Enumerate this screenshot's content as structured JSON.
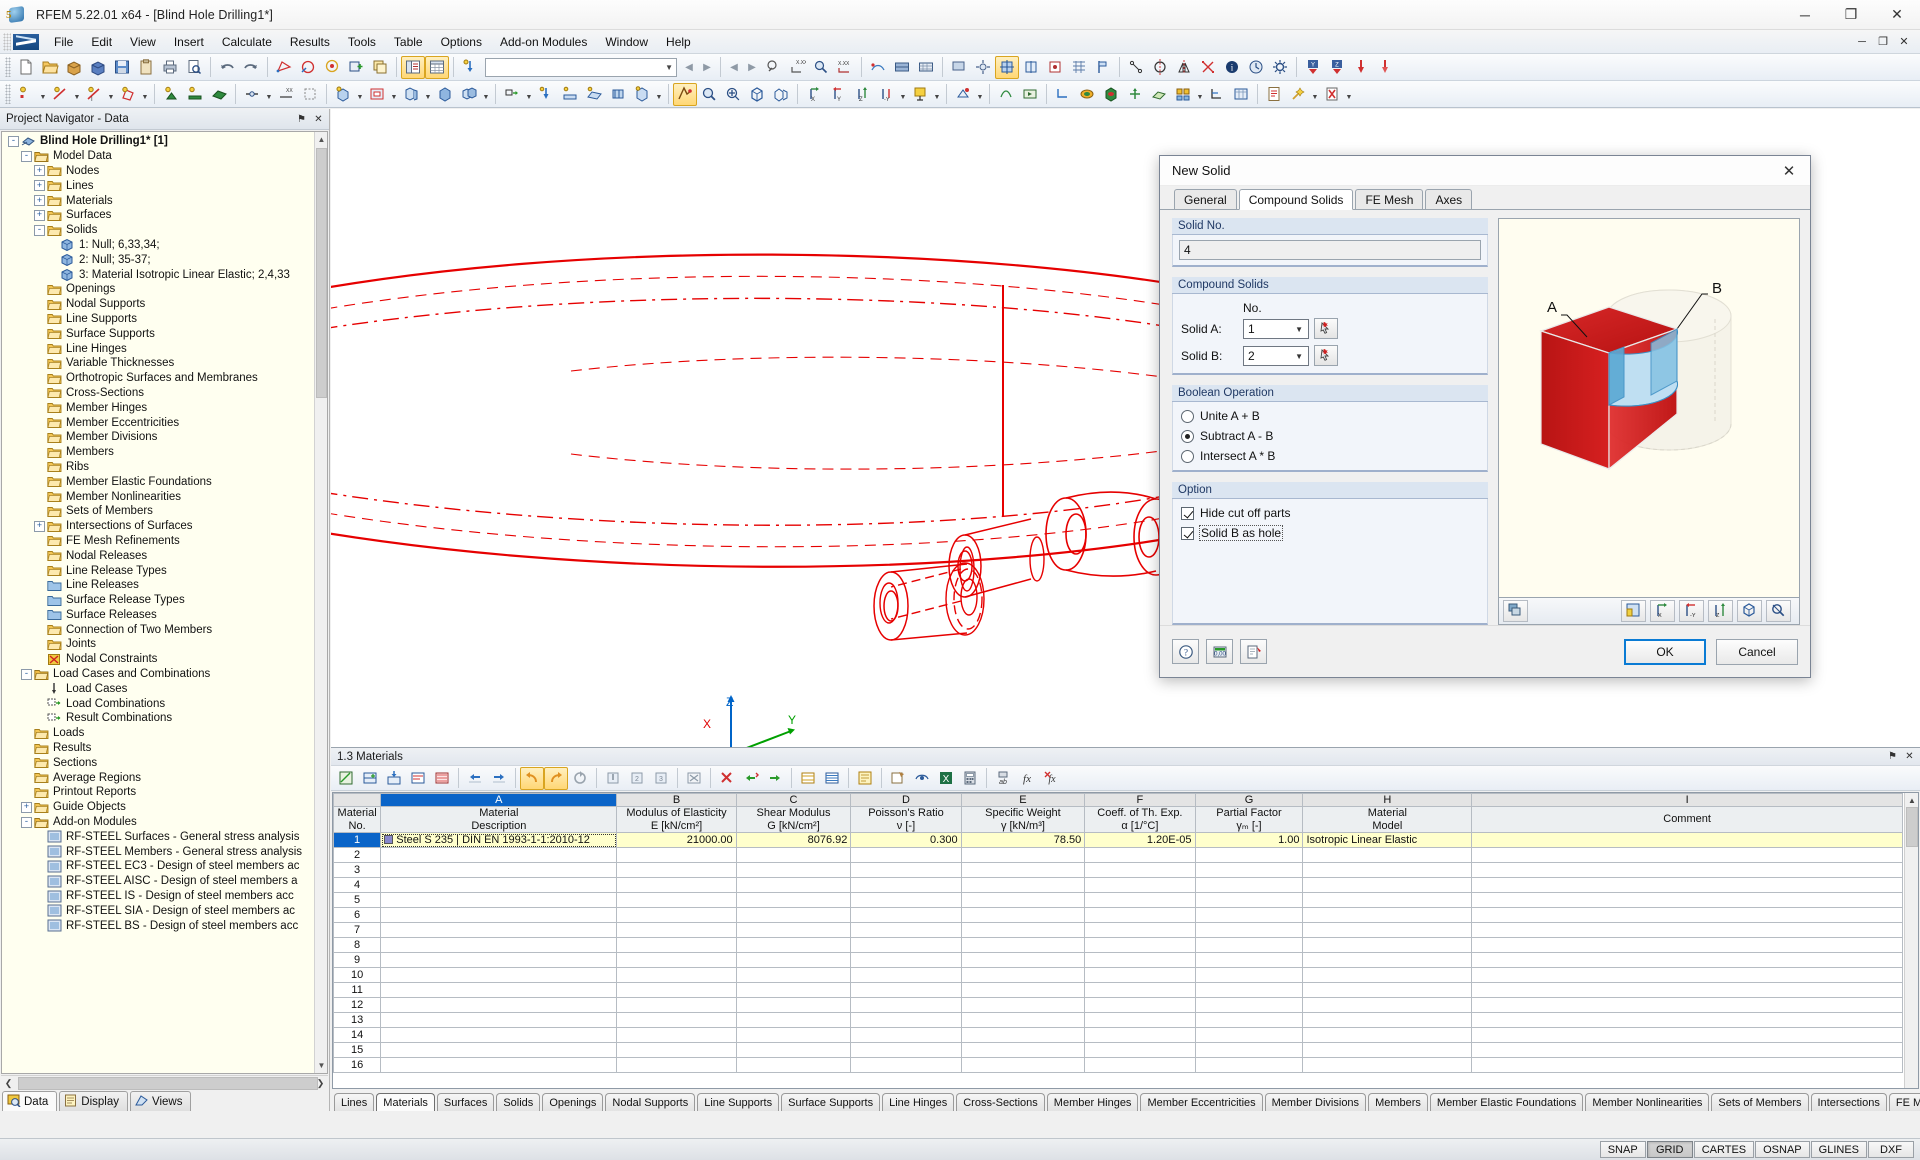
{
  "window": {
    "title": "RFEM 5.22.01 x64 - [Blind Hole Drilling1*]",
    "minimize": "─",
    "maximize": "❐",
    "close": "✕",
    "mdi_minimize": "─",
    "mdi_restore": "❐",
    "mdi_close": "✕"
  },
  "menu": {
    "items": [
      "File",
      "Edit",
      "View",
      "Insert",
      "Calculate",
      "Results",
      "Tools",
      "Table",
      "Options",
      "Add-on Modules",
      "Window",
      "Help"
    ]
  },
  "toolbar": {
    "combo_value": "",
    "prev_label": "◀",
    "next_label": "▶"
  },
  "navigator": {
    "title": "Project Navigator - Data",
    "pin": "⚑",
    "close": "✕",
    "tree": [
      {
        "depth": 0,
        "toggle": "-",
        "label": "Blind Hole Drilling1* [1]",
        "bold": true,
        "icon": "model-icon"
      },
      {
        "depth": 1,
        "toggle": "-",
        "label": "Model Data",
        "icon": "folder-open-icon"
      },
      {
        "depth": 2,
        "toggle": "+",
        "label": "Nodes",
        "icon": "nodes-icon"
      },
      {
        "depth": 2,
        "toggle": "+",
        "label": "Lines",
        "icon": "lines-icon"
      },
      {
        "depth": 2,
        "toggle": "+",
        "label": "Materials",
        "icon": "materials-icon"
      },
      {
        "depth": 2,
        "toggle": "+",
        "label": "Surfaces",
        "icon": "surfaces-icon"
      },
      {
        "depth": 2,
        "toggle": "-",
        "label": "Solids",
        "icon": "solids-icon"
      },
      {
        "depth": 3,
        "toggle": "",
        "label": "1: Null; 6,33,34;",
        "icon": "solid-item-icon"
      },
      {
        "depth": 3,
        "toggle": "",
        "label": "2: Null; 35-37;",
        "icon": "solid-item-icon"
      },
      {
        "depth": 3,
        "toggle": "",
        "label": "3: Material Isotropic Linear Elastic; 2,4,33",
        "icon": "solid-item-icon"
      },
      {
        "depth": 2,
        "toggle": "",
        "label": "Openings",
        "icon": "openings-icon"
      },
      {
        "depth": 2,
        "toggle": "",
        "label": "Nodal Supports",
        "icon": "nodal-supports-icon"
      },
      {
        "depth": 2,
        "toggle": "",
        "label": "Line Supports",
        "icon": "line-supports-icon"
      },
      {
        "depth": 2,
        "toggle": "",
        "label": "Surface Supports",
        "icon": "surface-supports-icon"
      },
      {
        "depth": 2,
        "toggle": "",
        "label": "Line Hinges",
        "icon": "line-hinges-icon"
      },
      {
        "depth": 2,
        "toggle": "",
        "label": "Variable Thicknesses",
        "icon": "variable-thickness-icon"
      },
      {
        "depth": 2,
        "toggle": "",
        "label": "Orthotropic Surfaces and Membranes",
        "icon": "orthotropic-icon"
      },
      {
        "depth": 2,
        "toggle": "",
        "label": "Cross-Sections",
        "icon": "cross-sections-icon"
      },
      {
        "depth": 2,
        "toggle": "",
        "label": "Member Hinges",
        "icon": "member-hinges-icon"
      },
      {
        "depth": 2,
        "toggle": "",
        "label": "Member Eccentricities",
        "icon": "member-ecc-icon"
      },
      {
        "depth": 2,
        "toggle": "",
        "label": "Member Divisions",
        "icon": "member-div-icon"
      },
      {
        "depth": 2,
        "toggle": "",
        "label": "Members",
        "icon": "members-icon"
      },
      {
        "depth": 2,
        "toggle": "",
        "label": "Ribs",
        "icon": "ribs-icon"
      },
      {
        "depth": 2,
        "toggle": "",
        "label": "Member Elastic Foundations",
        "icon": "member-found-icon"
      },
      {
        "depth": 2,
        "toggle": "",
        "label": "Member Nonlinearities",
        "icon": "member-nonlin-icon"
      },
      {
        "depth": 2,
        "toggle": "",
        "label": "Sets of Members",
        "icon": "sets-members-icon"
      },
      {
        "depth": 2,
        "toggle": "+",
        "label": "Intersections of Surfaces",
        "icon": "intersections-icon"
      },
      {
        "depth": 2,
        "toggle": "",
        "label": "FE Mesh Refinements",
        "icon": "fe-mesh-icon"
      },
      {
        "depth": 2,
        "toggle": "",
        "label": "Nodal Releases",
        "icon": "folder-icon"
      },
      {
        "depth": 2,
        "toggle": "",
        "label": "Line Release Types",
        "icon": "folder-icon"
      },
      {
        "depth": 2,
        "toggle": "",
        "label": "Line Releases",
        "icon": "folder-blue-icon"
      },
      {
        "depth": 2,
        "toggle": "",
        "label": "Surface Release Types",
        "icon": "folder-blue-icon"
      },
      {
        "depth": 2,
        "toggle": "",
        "label": "Surface Releases",
        "icon": "folder-blue-icon"
      },
      {
        "depth": 2,
        "toggle": "",
        "label": "Connection of Two Members",
        "icon": "folder-icon"
      },
      {
        "depth": 2,
        "toggle": "",
        "label": "Joints",
        "icon": "folder-icon"
      },
      {
        "depth": 2,
        "toggle": "",
        "label": "Nodal Constraints",
        "icon": "nodal-constraints-icon"
      },
      {
        "depth": 1,
        "toggle": "-",
        "label": "Load Cases and Combinations",
        "icon": "folder-open-icon"
      },
      {
        "depth": 2,
        "toggle": "",
        "label": "Load Cases",
        "icon": "load-cases-icon"
      },
      {
        "depth": 2,
        "toggle": "",
        "label": "Load Combinations",
        "icon": "load-comb-icon"
      },
      {
        "depth": 2,
        "toggle": "",
        "label": "Result Combinations",
        "icon": "result-comb-icon"
      },
      {
        "depth": 1,
        "toggle": "",
        "label": "Loads",
        "icon": "folder-icon"
      },
      {
        "depth": 1,
        "toggle": "",
        "label": "Results",
        "icon": "folder-icon"
      },
      {
        "depth": 1,
        "toggle": "",
        "label": "Sections",
        "icon": "folder-icon"
      },
      {
        "depth": 1,
        "toggle": "",
        "label": "Average Regions",
        "icon": "folder-icon"
      },
      {
        "depth": 1,
        "toggle": "",
        "label": "Printout Reports",
        "icon": "folder-icon"
      },
      {
        "depth": 1,
        "toggle": "+",
        "label": "Guide Objects",
        "icon": "folder-icon"
      },
      {
        "depth": 1,
        "toggle": "-",
        "label": "Add-on Modules",
        "icon": "folder-open-icon"
      },
      {
        "depth": 2,
        "toggle": "",
        "label": "RF-STEEL Surfaces - General stress analysis",
        "icon": "rf-steel-surfaces-icon"
      },
      {
        "depth": 2,
        "toggle": "",
        "label": "RF-STEEL Members - General stress analysis",
        "icon": "rf-steel-members-icon"
      },
      {
        "depth": 2,
        "toggle": "",
        "label": "RF-STEEL EC3 - Design of steel members ac",
        "icon": "rf-steel-ec3-icon"
      },
      {
        "depth": 2,
        "toggle": "",
        "label": "RF-STEEL AISC - Design of steel members a",
        "icon": "rf-steel-aisc-icon"
      },
      {
        "depth": 2,
        "toggle": "",
        "label": "RF-STEEL IS - Design of steel members acc",
        "icon": "rf-steel-is-icon"
      },
      {
        "depth": 2,
        "toggle": "",
        "label": "RF-STEEL SIA - Design of steel members ac",
        "icon": "rf-steel-sia-icon"
      },
      {
        "depth": 2,
        "toggle": "",
        "label": "RF-STEEL BS - Design of steel members acc",
        "icon": "rf-steel-bs-icon"
      }
    ],
    "tabs": [
      {
        "label": "Data",
        "icon": "data-icon",
        "selected": true
      },
      {
        "label": "Display",
        "icon": "display-icon",
        "selected": false
      },
      {
        "label": "Views",
        "icon": "views-icon",
        "selected": false
      }
    ]
  },
  "workarea": {
    "axis": {
      "z": "Z",
      "y": "Y",
      "x": "X"
    }
  },
  "dialog": {
    "title": "New Solid",
    "close": "✕",
    "tabs": [
      {
        "label": "General",
        "selected": false
      },
      {
        "label": "Compound Solids",
        "selected": true
      },
      {
        "label": "FE Mesh",
        "selected": false
      },
      {
        "label": "Axes",
        "selected": false
      }
    ],
    "solid_no": {
      "group": "Solid No.",
      "value": "4"
    },
    "compound": {
      "group": "Compound Solids",
      "no_header": "No.",
      "solid_a_label": "Solid A:",
      "solid_a_value": "1",
      "solid_b_label": "Solid B:",
      "solid_b_value": "2"
    },
    "boolean": {
      "group": "Boolean Operation",
      "options": [
        {
          "label": "Unite A + B",
          "selected": false
        },
        {
          "label": "Subtract A - B",
          "selected": true
        },
        {
          "label": "Intersect A * B",
          "selected": false
        }
      ]
    },
    "option": {
      "group": "Option",
      "checks": [
        {
          "label": "Hide cut off parts",
          "checked": true,
          "focused": false
        },
        {
          "label": "Solid B as hole",
          "checked": true,
          "focused": true
        }
      ]
    },
    "preview": {
      "label_a": "A",
      "label_b": "B",
      "solid_a_color": "#cc1111",
      "solid_b_color": "#e8e6e0",
      "cut_color": "#6bb6e0",
      "background": "#fffdf0"
    },
    "footer": {
      "ok": "OK",
      "cancel": "Cancel",
      "help_icon": "help-icon",
      "units_icon": "units-icon",
      "settings_icon": "settings-icon"
    },
    "preview_toolbar_icons": [
      "render-mode-icon",
      "view-plane-icon",
      "view-x-icon",
      "view-y-icon",
      "view-z-icon",
      "view-iso-icon",
      "zoom-all-icon"
    ]
  },
  "table": {
    "title": "1.3 Materials",
    "pin": "⚑",
    "close": "✕",
    "column_letters": [
      "A",
      "B",
      "C",
      "D",
      "E",
      "F",
      "G",
      "H",
      "I"
    ],
    "selected_letter": "A",
    "row_header": {
      "line1": "Material",
      "line2": "No."
    },
    "columns": [
      {
        "line1": "Material",
        "line2": "Description"
      },
      {
        "line1": "Modulus of Elasticity",
        "line2": "E [kN/cm²]"
      },
      {
        "line1": "Shear Modulus",
        "line2": "G [kN/cm²]"
      },
      {
        "line1": "Poisson's Ratio",
        "line2": "ν [-]"
      },
      {
        "line1": "Specific Weight",
        "line2": "γ [kN/m³]"
      },
      {
        "line1": "Coeff. of Th. Exp.",
        "line2": "α [1/°C]"
      },
      {
        "line1": "Partial Factor",
        "line2": "γₘ [-]"
      },
      {
        "line1": "Material",
        "line2": "Model"
      },
      {
        "line1": "",
        "line2": "Comment"
      }
    ],
    "rows": [
      {
        "no": "1",
        "selected": true,
        "data": [
          "Steel S 235 | DIN EN 1993-1-1:2010-12",
          "21000.00",
          "8076.92",
          "0.300",
          "78.50",
          "1.20E-05",
          "1.00",
          "Isotropic Linear Elastic",
          ""
        ]
      },
      {
        "no": "2",
        "selected": false,
        "data": [
          "",
          "",
          "",
          "",
          "",
          "",
          "",
          "",
          ""
        ]
      },
      {
        "no": "3",
        "selected": false,
        "data": [
          "",
          "",
          "",
          "",
          "",
          "",
          "",
          "",
          ""
        ]
      },
      {
        "no": "4",
        "selected": false,
        "data": [
          "",
          "",
          "",
          "",
          "",
          "",
          "",
          "",
          ""
        ]
      },
      {
        "no": "5",
        "selected": false,
        "data": [
          "",
          "",
          "",
          "",
          "",
          "",
          "",
          "",
          ""
        ]
      },
      {
        "no": "6",
        "selected": false,
        "data": [
          "",
          "",
          "",
          "",
          "",
          "",
          "",
          "",
          ""
        ]
      },
      {
        "no": "7",
        "selected": false,
        "data": [
          "",
          "",
          "",
          "",
          "",
          "",
          "",
          "",
          ""
        ]
      },
      {
        "no": "8",
        "selected": false,
        "data": [
          "",
          "",
          "",
          "",
          "",
          "",
          "",
          "",
          ""
        ]
      },
      {
        "no": "9",
        "selected": false,
        "data": [
          "",
          "",
          "",
          "",
          "",
          "",
          "",
          "",
          ""
        ]
      },
      {
        "no": "10",
        "selected": false,
        "data": [
          "",
          "",
          "",
          "",
          "",
          "",
          "",
          "",
          ""
        ]
      },
      {
        "no": "11",
        "selected": false,
        "data": [
          "",
          "",
          "",
          "",
          "",
          "",
          "",
          "",
          ""
        ]
      },
      {
        "no": "12",
        "selected": false,
        "data": [
          "",
          "",
          "",
          "",
          "",
          "",
          "",
          "",
          ""
        ]
      },
      {
        "no": "13",
        "selected": false,
        "data": [
          "",
          "",
          "",
          "",
          "",
          "",
          "",
          "",
          ""
        ]
      },
      {
        "no": "14",
        "selected": false,
        "data": [
          "",
          "",
          "",
          "",
          "",
          "",
          "",
          "",
          ""
        ]
      },
      {
        "no": "15",
        "selected": false,
        "data": [
          "",
          "",
          "",
          "",
          "",
          "",
          "",
          "",
          ""
        ]
      },
      {
        "no": "16",
        "selected": false,
        "data": [
          "",
          "",
          "",
          "",
          "",
          "",
          "",
          "",
          ""
        ]
      }
    ],
    "tabs": [
      {
        "label": "Lines",
        "selected": false
      },
      {
        "label": "Materials",
        "selected": true
      },
      {
        "label": "Surfaces",
        "selected": false
      },
      {
        "label": "Solids",
        "selected": false
      },
      {
        "label": "Openings",
        "selected": false
      },
      {
        "label": "Nodal Supports",
        "selected": false
      },
      {
        "label": "Line Supports",
        "selected": false
      },
      {
        "label": "Surface Supports",
        "selected": false
      },
      {
        "label": "Line Hinges",
        "selected": false
      },
      {
        "label": "Cross-Sections",
        "selected": false
      },
      {
        "label": "Member Hinges",
        "selected": false
      },
      {
        "label": "Member Eccentricities",
        "selected": false
      },
      {
        "label": "Member Divisions",
        "selected": false
      },
      {
        "label": "Members",
        "selected": false
      },
      {
        "label": "Member Elastic Foundations",
        "selected": false
      },
      {
        "label": "Member Nonlinearities",
        "selected": false
      },
      {
        "label": "Sets of Members",
        "selected": false
      },
      {
        "label": "Intersections",
        "selected": false
      },
      {
        "label": "FE Mesh Refinements",
        "selected": false
      }
    ],
    "tab_nav": [
      "⏮",
      "◀",
      "▶",
      "⏭"
    ]
  },
  "statusbar": {
    "toggles": [
      {
        "label": "SNAP",
        "on": false
      },
      {
        "label": "GRID",
        "on": true
      },
      {
        "label": "CARTES",
        "on": false
      },
      {
        "label": "OSNAP",
        "on": false
      },
      {
        "label": "GLINES",
        "on": false
      },
      {
        "label": "DXF",
        "on": false
      }
    ]
  }
}
